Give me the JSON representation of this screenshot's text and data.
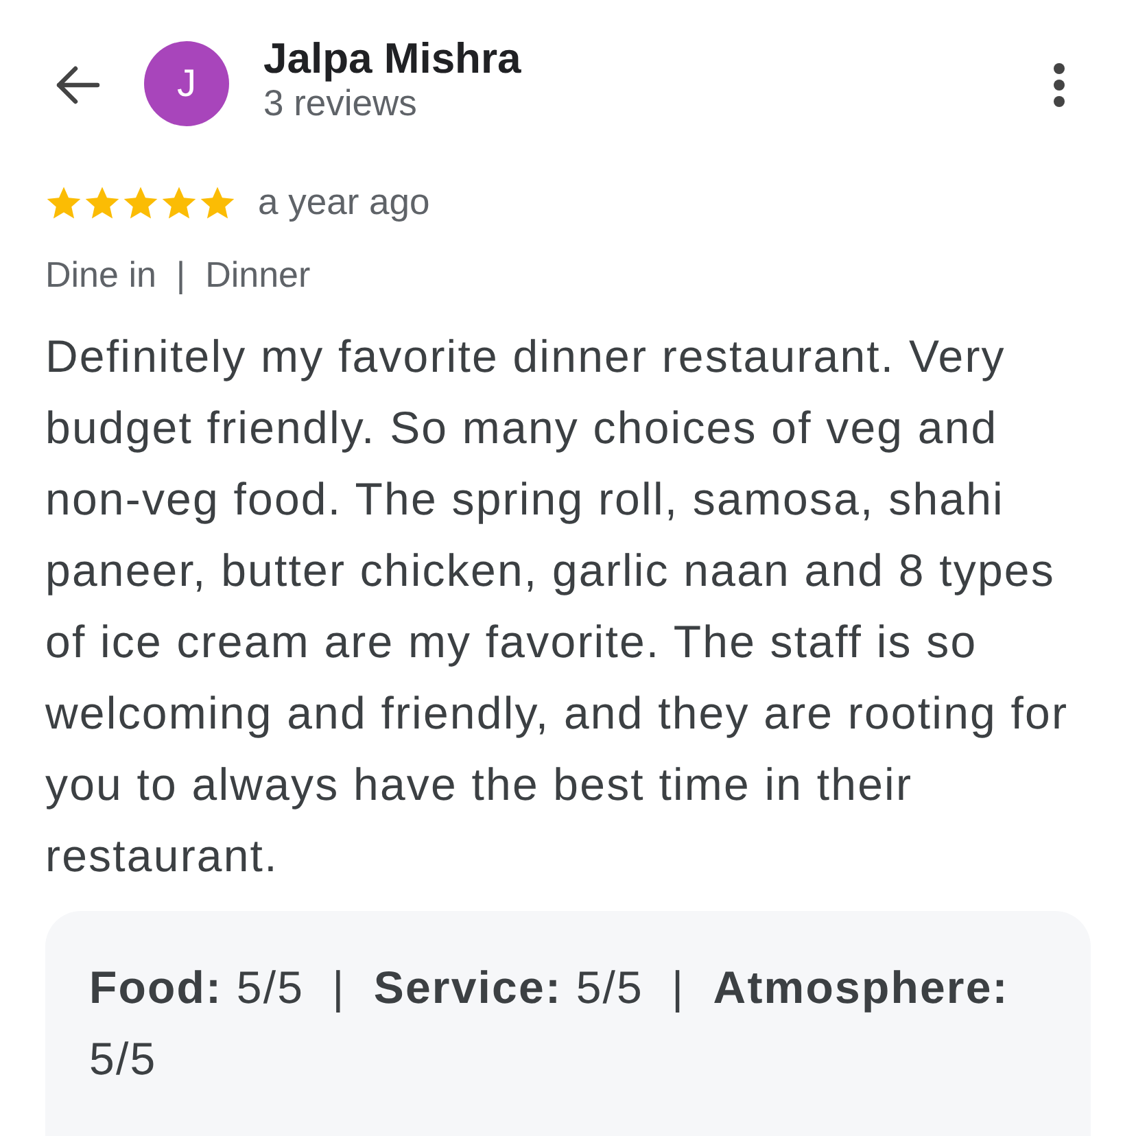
{
  "header": {
    "avatar_letter": "J",
    "name": "Jalpa Mishra",
    "subtitle": "3 reviews"
  },
  "review": {
    "stars": 5,
    "time": "a year ago",
    "tags": "Dine in  |  Dinner",
    "text": "Definitely my favorite dinner restaurant. Very budget friendly. So many choices of veg and non-veg food. The spring roll, samosa, shahi paneer, butter chicken, garlic naan and 8 types of ice cream are my favorite. The staff is so welcoming and friendly, and they are rooting for you to always have the best time in their restaurant.",
    "ratings": "**Food:** 5/5  |  **Service:** 5/5  |  **Atmosphere:** 5/5"
  }
}
